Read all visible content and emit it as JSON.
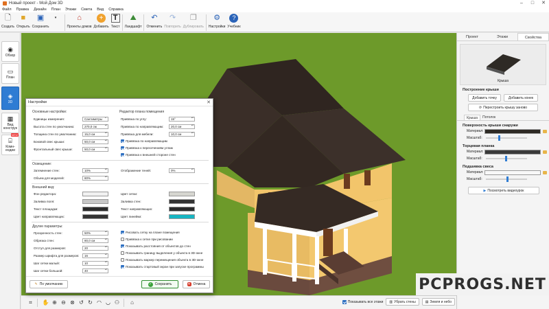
{
  "window": {
    "title": "Новый проект - Мой Дом 3D"
  },
  "menu": [
    "Файл",
    "Правка",
    "Дизайн",
    "План",
    "Этажи",
    "Смета",
    "Вид",
    "Справка"
  ],
  "toolbar": [
    {
      "name": "create",
      "label": "Создать",
      "icon": "new-doc-icon",
      "disabled": false
    },
    {
      "name": "open",
      "label": "Открыть",
      "icon": "folder-open-icon",
      "disabled": false
    },
    {
      "name": "save",
      "label": "Сохранить",
      "icon": "save-icon",
      "disabled": false
    },
    {
      "name": "house-projects",
      "label": "Проекты домов",
      "icon": "house-icon",
      "disabled": false
    },
    {
      "name": "add",
      "label": "Добавить",
      "icon": "plus-icon",
      "disabled": false
    },
    {
      "name": "text",
      "label": "Текст",
      "icon": "text-icon",
      "disabled": false
    },
    {
      "name": "landscape",
      "label": "Ландшафт",
      "icon": "landscape-icon",
      "disabled": false
    },
    {
      "name": "undo",
      "label": "Отменить",
      "icon": "undo-icon",
      "disabled": false
    },
    {
      "name": "redo",
      "label": "Повторить",
      "icon": "redo-icon",
      "disabled": true
    },
    {
      "name": "duplicate",
      "label": "Дублировать",
      "icon": "duplicate-icon",
      "disabled": true
    },
    {
      "name": "settings",
      "label": "Настройки",
      "icon": "gear-icon",
      "disabled": false
    },
    {
      "name": "tutorial",
      "label": "Учебник",
      "icon": "help-icon",
      "disabled": false
    }
  ],
  "left_tabs": [
    {
      "label": "Обзор",
      "icon": "eye-icon"
    },
    {
      "label": "План",
      "icon": "plan-icon"
    },
    {
      "label": "3D",
      "icon": "cube-icon"
    },
    {
      "label": "Вид конструк",
      "icon": "structure-icon"
    },
    {
      "label": "Комн-ендии",
      "icon": "rooms-icon",
      "badge": "NEW"
    }
  ],
  "right_panel": {
    "tabs": [
      "Проект",
      "Этажи",
      "Свойства"
    ],
    "preview_caption": "Крыша",
    "roof_heading": "Построение крыши",
    "add_point": "Добавить точку",
    "add_ridge": "Добавить конек",
    "rebuild": "Перестроить крышу заново",
    "subtabs": [
      "Крыша",
      "Потолок"
    ],
    "outer_surface": "Поверхность крыши снаружи",
    "fascia": "Торцевая планка",
    "soffit": "Подшивка свеса",
    "material_label": "Материал:",
    "scale_label": "Масштаб:",
    "video_button": "Посмотреть видеоурок",
    "colors": {
      "roof_material": "#2e2a25",
      "fascia_material": "#3a3a3a",
      "soffit_material": "#f7f7f7"
    }
  },
  "dialog": {
    "title": "Настройки",
    "basic": {
      "heading": "Основные настройки:",
      "rows": [
        {
          "label": "Единицы измерения:",
          "value": "Сантиметры",
          "kind": "select"
        },
        {
          "label": "Высота стен по умолчанию:",
          "value": "270,0 см",
          "kind": "spin"
        },
        {
          "label": "Толщина стен по умолчанию:",
          "value": "15,0 см",
          "kind": "spin"
        },
        {
          "label": "Боковой свес крыши:",
          "value": "50,0 см",
          "kind": "spin"
        },
        {
          "label": "Фронтальный свес крыши:",
          "value": "50,0 см",
          "kind": "spin"
        }
      ]
    },
    "editor": {
      "heading": "Редактор плана помещения",
      "rows": [
        {
          "label": "Привязка по углу:",
          "value": "15°"
        },
        {
          "label": "Привязка по направляющим:",
          "value": "20,0 см"
        },
        {
          "label": "Привязка для мебели:",
          "value": "10,0 см"
        }
      ],
      "checks": [
        {
          "label": "Привязка по направляющим",
          "checked": true
        },
        {
          "label": "Привязка к пересечениям углам",
          "checked": true
        },
        {
          "label": "Привязка к внешней стороне стен",
          "checked": true
        }
      ]
    },
    "lighting": {
      "heading": "Освещение:",
      "rows": [
        {
          "label": "Затемнение стен:",
          "value": "10%"
        },
        {
          "label": "Объем для моделей:",
          "value": "80%"
        }
      ],
      "shadows_label": "Отображение теней:",
      "shadows_value": "0%"
    },
    "appearance": {
      "heading": "Внешний вид:",
      "left": [
        {
          "label": "Фон редактора:",
          "color": "#f1f1f1"
        },
        {
          "label": "Заливка поля:",
          "color": "#c7c7c7"
        },
        {
          "label": "Текст площадки:",
          "color": "#2b2b2b"
        },
        {
          "label": "Цвет направляющих:",
          "color": "#333333"
        }
      ],
      "right": [
        {
          "label": "Цвет сетки:",
          "color": "#d6d6d0"
        },
        {
          "label": "Заливка стен:",
          "color": "#343434"
        },
        {
          "label": "Текст направляющих:",
          "color": "#2b2b2b"
        },
        {
          "label": "Цвет линейки:",
          "color": "#17b5c2"
        }
      ]
    },
    "other": {
      "heading": "Другие параметры:",
      "rows": [
        {
          "label": "Прозрачность стен:",
          "value": "50%"
        },
        {
          "label": "Обрезка стен:",
          "value": "80,0 см"
        },
        {
          "label": "Отступ для размеров:",
          "value": "20"
        },
        {
          "label": "Размер шрифта для размеров:",
          "value": "16"
        },
        {
          "label": "Шаг сетки малый:",
          "value": "10"
        },
        {
          "label": "Шаг сетки большой:",
          "value": "40"
        }
      ],
      "checks": [
        {
          "label": "Рисовать сетку на плане помещения",
          "checked": true
        },
        {
          "label": "Привязка к сетке при рисовании",
          "checked": false
        },
        {
          "label": "Показывать расстояния от объектов до стен",
          "checked": true
        },
        {
          "label": "Показывать границу выделения у объекта в 3D-окне",
          "checked": false
        },
        {
          "label": "Показывать маркер перемещения объекта в 3D-окне",
          "checked": false
        },
        {
          "label": "Показывать стартовый экран при запуске программы",
          "checked": true
        }
      ]
    },
    "defaults_button": "По умолчанию",
    "save_button": "Сохранить",
    "cancel_button": "Отмена"
  },
  "bottom": {
    "show_all_walls": "Показывать все этажи",
    "remove_walls": "Убрать стены",
    "earth_sky": "Земля и небо"
  },
  "watermark": "PCPROGS.NET"
}
